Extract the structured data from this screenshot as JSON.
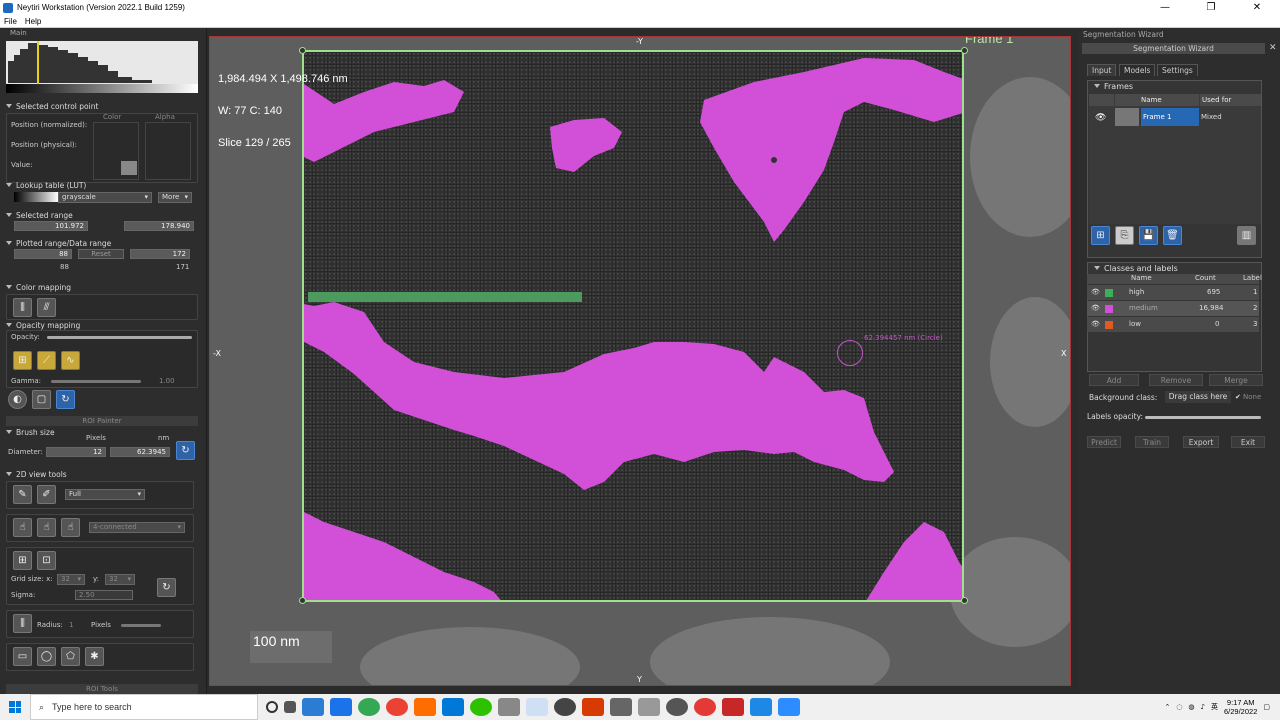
{
  "window": {
    "title": "Neytiri Workstation (Version 2022.1 Build 1259)",
    "minimize": "—",
    "maximize": "❐",
    "close": "✕"
  },
  "menu": [
    "File",
    "Help"
  ],
  "left": {
    "header": "Main",
    "control_point": {
      "title": "Selected control point",
      "position_norm": "Position (normalized):",
      "position_phys": "Position (physical):",
      "value": "Value:",
      "color": "Color",
      "alpha": "Alpha"
    },
    "lut": {
      "title": "Lookup table (LUT)",
      "value": "grayscale",
      "more": "More"
    },
    "selected_range": {
      "title": "Selected range",
      "min": "101.972",
      "max": "178.940"
    },
    "plotted_range": {
      "title": "Plotted range/Data range",
      "a": "88",
      "reset": "Reset",
      "b": "172",
      "c": "88",
      "d": "171"
    },
    "color_mapping": {
      "title": "Color mapping"
    },
    "opacity_mapping": {
      "title": "Opacity mapping",
      "opacity": "Opacity:",
      "gamma": "Gamma:",
      "gamma_value": "1.00"
    },
    "roi_painter": "ROI Painter",
    "brush": {
      "title": "Brush size",
      "pixels": "Pixels",
      "nm": "nm",
      "diameter": "Diameter:",
      "px_value": "12",
      "nm_value": "62.3945"
    },
    "tools2d": {
      "title": "2D view tools",
      "mode": "Full",
      "connectivity": "4-connected",
      "grid_x_label": "Grid size: x:",
      "grid_x": "32",
      "grid_y_label": "y:",
      "grid_y": "32",
      "sigma_label": "Sigma:",
      "sigma": "2.50",
      "radius_label": "Radius:",
      "radius": "1",
      "pixels_label": "Pixels"
    },
    "roi_tools": "ROI Tools"
  },
  "viewer": {
    "dimensions": "1,984.494 X 1,498.746 nm",
    "wc": "W: 77 C: 140",
    "slice": "Slice 129 / 265",
    "frame_label": "Frame 1",
    "scale": "100 nm",
    "axis_top": "-Y",
    "axis_bottom": "Y",
    "axis_left": "-X",
    "axis_right": "X",
    "cursor_label": "62.394457 nm (Circle)"
  },
  "right": {
    "header": "Segmentation Wizard",
    "subheader": "Segmentation Wizard",
    "tabs": [
      "Input",
      "Models",
      "Settings"
    ],
    "frames": {
      "title": "Frames",
      "col_name": "Name",
      "col_used": "Used for",
      "row_name": "Frame 1",
      "row_used": "Mixed"
    },
    "classes": {
      "title": "Classes and labels",
      "col_name": "Name",
      "col_count": "Count",
      "col_label": "Label",
      "rows": [
        {
          "name": "high",
          "count": "695",
          "label": "1",
          "color": "#3fae5a"
        },
        {
          "name": "medium",
          "count": "16,984",
          "label": "2",
          "color": "#d24fd8"
        },
        {
          "name": "low",
          "count": "0",
          "label": "3",
          "color": "#e05a28"
        }
      ]
    },
    "add": "Add",
    "remove": "Remove",
    "merge": "Merge",
    "background_class": "Background class:",
    "drag_class": "Drag class here",
    "none": "None",
    "labels_opacity": "Labels opacity:",
    "predict": "Predict",
    "train": "Train",
    "export": "Export",
    "exit": "Exit"
  },
  "taskbar": {
    "search_placeholder": "Type here to search",
    "time": "9:17 AM",
    "date": "6/29/2022",
    "lang": "英"
  },
  "colors": {
    "segmentation": "#d24fd8",
    "high_class": "#4c9a5e",
    "frame_border": "#9fe08f"
  }
}
